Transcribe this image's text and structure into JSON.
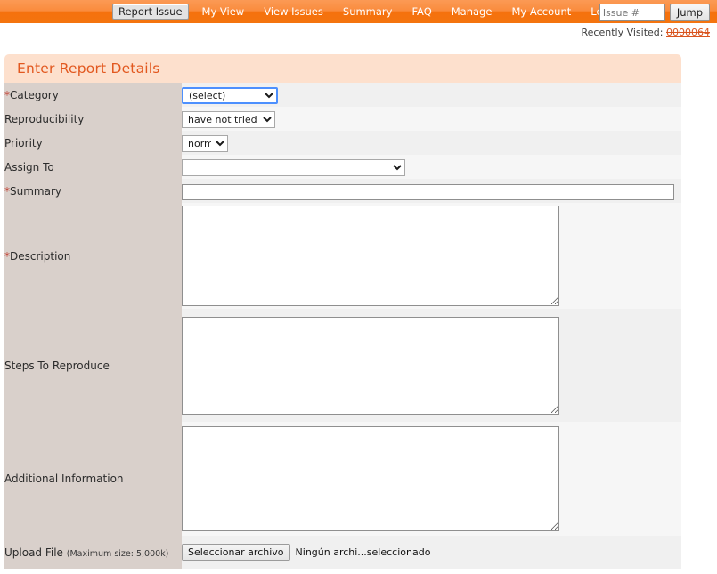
{
  "nav": {
    "items": [
      {
        "label": "Report Issue",
        "active": true
      },
      {
        "label": "My View",
        "active": false
      },
      {
        "label": "View Issues",
        "active": false
      },
      {
        "label": "Summary",
        "active": false
      },
      {
        "label": "FAQ",
        "active": false
      },
      {
        "label": "Manage",
        "active": false
      },
      {
        "label": "My Account",
        "active": false
      },
      {
        "label": "Logout",
        "active": false
      }
    ],
    "issue_placeholder": "Issue #",
    "issue_value": "",
    "jump_label": "Jump"
  },
  "recent": {
    "label": "Recently Visited:",
    "link": "0000064"
  },
  "panel": {
    "title": "Enter Report Details"
  },
  "form": {
    "category": {
      "label": "Category",
      "required": "*",
      "value": "(select)",
      "options": [
        "(select)"
      ]
    },
    "reproducibility": {
      "label": "Reproducibility",
      "required": "",
      "value": "have not tried",
      "options": [
        "have not tried"
      ]
    },
    "priority": {
      "label": "Priority",
      "required": "",
      "value": "normal",
      "options": [
        "normal"
      ]
    },
    "assign_to": {
      "label": "Assign To",
      "required": "",
      "value": "",
      "options": [
        ""
      ]
    },
    "summary": {
      "label": "Summary",
      "required": "*",
      "value": "",
      "placeholder": ""
    },
    "description": {
      "label": "Description",
      "required": "*",
      "value": ""
    },
    "steps_to_reproduce": {
      "label": "Steps To Reproduce",
      "required": "",
      "value": ""
    },
    "additional_information": {
      "label": "Additional Information",
      "required": "",
      "value": ""
    },
    "upload_file": {
      "label": "Upload File",
      "hint": "(Maximum size: 5,000k)",
      "button_label": "Seleccionar archivo",
      "file_status": "Ningún archi...seleccionado"
    }
  },
  "colors": {
    "nav_orange": "#f5760f",
    "panel_header": "#fde0cd",
    "panel_title": "#e2581f",
    "label_bg": "#d9d0cb",
    "row_odd": "#f0f0f0",
    "row_even": "#f6f6f6",
    "required_star": "#c0392b",
    "focus_border": "#4d90fe",
    "link": "#d9541e"
  }
}
